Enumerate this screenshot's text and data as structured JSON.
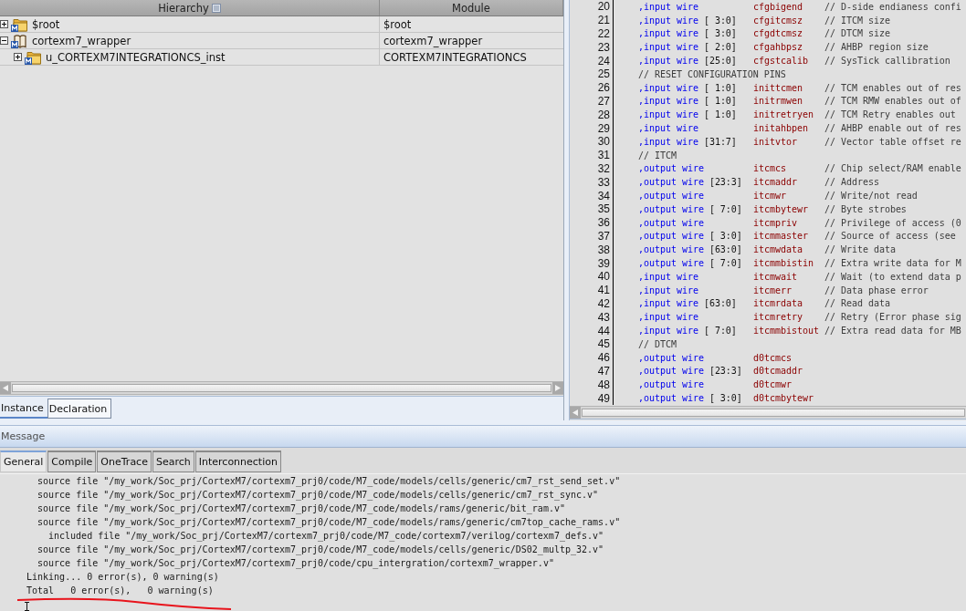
{
  "hierarchy": {
    "columns": [
      {
        "label": "Hierarchy",
        "menu": true
      },
      {
        "label": "Module",
        "menu": false
      }
    ],
    "rows": [
      {
        "name": "$root",
        "module": "$root",
        "kind": "folder",
        "expanded": false
      },
      {
        "name": "cortexm7_wrapper",
        "module": "cortexm7_wrapper",
        "kind": "book",
        "expanded": true,
        "children": [
          {
            "name": "u_CORTEXM7INTEGRATIONCS_inst",
            "module": "CORTEXM7INTEGRATIONCS",
            "kind": "folder",
            "expanded": false
          }
        ]
      }
    ],
    "tabs": [
      {
        "label": "Instance",
        "selected": true
      },
      {
        "label": "Declaration",
        "selected": false
      }
    ]
  },
  "code": {
    "lines": [
      {
        "number": "20",
        "kind": "port",
        "direction": ",input wire",
        "signal": "cfgbigend",
        "comment": "// D-side endianess confi"
      },
      {
        "number": "21",
        "kind": "port",
        "direction": ",input wire",
        "range": "[ 3:0]",
        "signal": "cfgitcmsz",
        "comment": "// ITCM size"
      },
      {
        "number": "22",
        "kind": "port",
        "direction": ",input wire",
        "range": "[ 3:0]",
        "signal": "cfgdtcmsz",
        "comment": "// DTCM size"
      },
      {
        "number": "23",
        "kind": "port",
        "direction": ",input wire",
        "range": "[ 2:0]",
        "signal": "cfgahbpsz",
        "comment": "// AHBP region size"
      },
      {
        "number": "24",
        "kind": "port",
        "direction": ",input wire",
        "range": "[25:0]",
        "signal": "cfgstcalib",
        "comment": "// SysTick callibration"
      },
      {
        "number": "25",
        "kind": "comment",
        "comment": "// RESET CONFIGURATION PINS"
      },
      {
        "number": "26",
        "kind": "port",
        "direction": ",input wire",
        "range": "[ 1:0]",
        "signal": "inittcmen",
        "comment": "// TCM enables out of res"
      },
      {
        "number": "27",
        "kind": "port",
        "direction": ",input wire",
        "range": "[ 1:0]",
        "signal": "initrmwen",
        "comment": "// TCM RMW enables out of"
      },
      {
        "number": "28",
        "kind": "port",
        "direction": ",input wire",
        "range": "[ 1:0]",
        "signal": "initretryen",
        "comment": "// TCM Retry enables out"
      },
      {
        "number": "29",
        "kind": "port",
        "direction": ",input wire",
        "signal": "initahbpen",
        "comment": "// AHBP enable out of res"
      },
      {
        "number": "30",
        "kind": "port",
        "direction": ",input wire",
        "range": "[31:7]",
        "signal": "initvtor",
        "comment": "// Vector table offset re"
      },
      {
        "number": "31",
        "kind": "comment",
        "comment": "// ITCM"
      },
      {
        "number": "32",
        "kind": "port",
        "direction": ",output wire",
        "signal": "itcmcs",
        "comment": "// Chip select/RAM enable"
      },
      {
        "number": "33",
        "kind": "port",
        "direction": ",output wire",
        "range": "[23:3]",
        "signal": "itcmaddr",
        "comment": "// Address"
      },
      {
        "number": "34",
        "kind": "port",
        "direction": ",output wire",
        "signal": "itcmwr",
        "comment": "// Write/not read"
      },
      {
        "number": "35",
        "kind": "port",
        "direction": ",output wire",
        "range": "[ 7:0]",
        "signal": "itcmbytewr",
        "comment": "// Byte strobes"
      },
      {
        "number": "36",
        "kind": "port",
        "direction": ",output wire",
        "signal": "itcmpriv",
        "comment": "// Privilege of access (0"
      },
      {
        "number": "37",
        "kind": "port",
        "direction": ",output wire",
        "range": "[ 3:0]",
        "signal": "itcmmaster",
        "comment": "// Source of access (see"
      },
      {
        "number": "38",
        "kind": "port",
        "direction": ",output wire",
        "range": "[63:0]",
        "signal": "itcmwdata",
        "comment": "// Write data"
      },
      {
        "number": "39",
        "kind": "port",
        "direction": ",output wire",
        "range": "[ 7:0]",
        "signal": "itcmmbistin",
        "comment": "// Extra write data for M"
      },
      {
        "number": "40",
        "kind": "port",
        "direction": ",input wire",
        "signal": "itcmwait",
        "comment": "// Wait (to extend data p"
      },
      {
        "number": "41",
        "kind": "port",
        "direction": ",input wire",
        "signal": "itcmerr",
        "comment": "// Data phase error"
      },
      {
        "number": "42",
        "kind": "port",
        "direction": ",input wire",
        "range": "[63:0]",
        "signal": "itcmrdata",
        "comment": "// Read data"
      },
      {
        "number": "43",
        "kind": "port",
        "direction": ",input wire",
        "signal": "itcmretry",
        "comment": "// Retry (Error phase sig"
      },
      {
        "number": "44",
        "kind": "port",
        "direction": ",input wire",
        "range": "[ 7:0]",
        "signal": "itcmmbistout",
        "comment": "// Extra read data for MB"
      },
      {
        "number": "45",
        "kind": "comment",
        "comment": "// DTCM"
      },
      {
        "number": "46",
        "kind": "port",
        "direction": ",output wire",
        "signal": "d0tcmcs"
      },
      {
        "number": "47",
        "kind": "port",
        "direction": ",output wire",
        "range": "[23:3]",
        "signal": "d0tcmaddr"
      },
      {
        "number": "48",
        "kind": "port",
        "direction": ",output wire",
        "signal": "d0tcmwr"
      },
      {
        "number": "49",
        "kind": "port",
        "direction": ",output wire",
        "range": "[ 3:0]",
        "signal": "d0tcmbytewr"
      }
    ]
  },
  "message": {
    "title": "Message",
    "tabs": [
      {
        "label": "General",
        "selected": true
      },
      {
        "label": "Compile",
        "selected": false
      },
      {
        "label": "OneTrace",
        "selected": false
      },
      {
        "label": "Search",
        "selected": false
      },
      {
        "label": "Interconnection",
        "selected": false
      }
    ],
    "lines": [
      {
        "kind": "source",
        "text": "source file \"/my_work/Soc_prj/CortexM7/cortexm7_prj0/code/M7_code/models/cells/generic/cm7_rst_send_set.v\""
      },
      {
        "kind": "source",
        "text": "source file \"/my_work/Soc_prj/CortexM7/cortexm7_prj0/code/M7_code/models/cells/generic/cm7_rst_sync.v\""
      },
      {
        "kind": "source",
        "text": "source file \"/my_work/Soc_prj/CortexM7/cortexm7_prj0/code/M7_code/models/rams/generic/bit_ram.v\""
      },
      {
        "kind": "source",
        "text": "source file \"/my_work/Soc_prj/CortexM7/cortexm7_prj0/code/M7_code/models/rams/generic/cm7top_cache_rams.v\""
      },
      {
        "kind": "included",
        "text": "included file \"/my_work/Soc_prj/CortexM7/cortexm7_prj0/code/M7_code/cortexm7/verilog/cortexm7_defs.v\""
      },
      {
        "kind": "source",
        "text": "source file \"/my_work/Soc_prj/CortexM7/cortexm7_prj0/code/M7_code/models/cells/generic/DS02_multp_32.v\""
      },
      {
        "kind": "source",
        "text": "source file \"/my_work/Soc_prj/CortexM7/cortexm7_prj0/code/cpu_intergration/cortexm7_wrapper.v\""
      },
      {
        "kind": "summary",
        "text": "Linking... 0 error(s), 0 warning(s)"
      },
      {
        "kind": "summary",
        "text": "Total   0 error(s),   0 warning(s)"
      }
    ]
  }
}
